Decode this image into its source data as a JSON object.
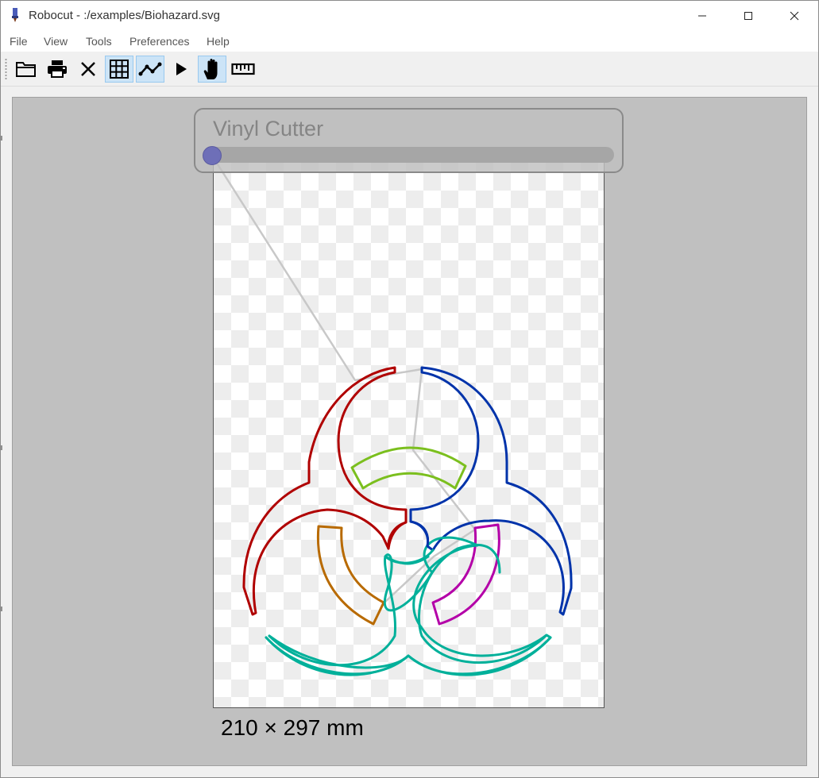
{
  "window": {
    "title": "Robocut - :/examples/Biohazard.svg",
    "controls": [
      "minimize",
      "maximize",
      "close"
    ]
  },
  "menu": {
    "file": "File",
    "view": "View",
    "tools": "Tools",
    "preferences": "Preferences",
    "help": "Help"
  },
  "toolbar": {
    "tools": [
      {
        "name": "open",
        "icon": "folder-open-icon",
        "active": false
      },
      {
        "name": "cut",
        "icon": "printer-icon",
        "active": false
      },
      {
        "name": "close-file",
        "icon": "close-icon",
        "active": false
      },
      {
        "name": "grid",
        "icon": "grid-icon",
        "active": true
      },
      {
        "name": "cut-path",
        "icon": "path-icon",
        "active": true
      },
      {
        "name": "animate",
        "icon": "play-icon",
        "active": false
      },
      {
        "name": "pan",
        "icon": "hand-icon",
        "active": true
      },
      {
        "name": "dimensions",
        "icon": "ruler-icon",
        "active": false
      }
    ]
  },
  "device": {
    "label": "Vinyl Cutter",
    "progress": 0
  },
  "paper": {
    "size_label": "210 × 297 mm"
  },
  "colors": {
    "red_path": "#b00000",
    "blue_path": "#0033aa",
    "green_path": "#7bbf1e",
    "orange_path": "#b86a00",
    "magenta_path": "#b400a8",
    "teal_path": "#00b09a",
    "travel_path": "#c8c8c8",
    "viewport_bg": "#c0c0c0"
  }
}
